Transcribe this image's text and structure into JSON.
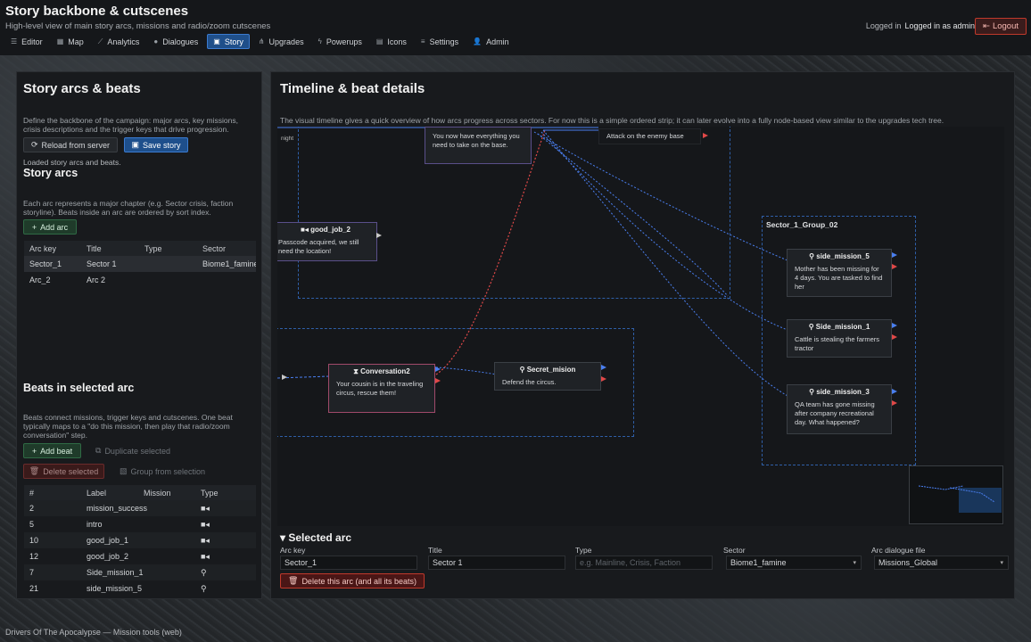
{
  "app": {
    "title": "Story backbone & cutscenes",
    "subtitle": "High-level view of main story arcs, missions and radio/zoom cutscenes",
    "login_status": "Logged in",
    "login_user": "Logged in as admin",
    "logout_label": "Logout"
  },
  "nav": [
    {
      "label": "Editor",
      "icon": "list-icon"
    },
    {
      "label": "Map",
      "icon": "map-icon"
    },
    {
      "label": "Analytics",
      "icon": "chart-icon"
    },
    {
      "label": "Dialogues",
      "icon": "chat-icon"
    },
    {
      "label": "Story",
      "icon": "book-icon",
      "active": true
    },
    {
      "label": "Upgrades",
      "icon": "tree-icon"
    },
    {
      "label": "Powerups",
      "icon": "bolt-icon"
    },
    {
      "label": "Icons",
      "icon": "grid-icon"
    },
    {
      "label": "Settings",
      "icon": "sliders-icon"
    },
    {
      "label": "Admin",
      "icon": "users-icon"
    }
  ],
  "left": {
    "title": "Story arcs & beats",
    "description": "Define the backbone of the campaign: major arcs, key missions, crisis descriptions and the trigger keys that drive progression.",
    "reload_label": "Reload from server",
    "save_label": "Save story",
    "status": "Loaded story arcs and beats.",
    "arcs_title": "Story arcs",
    "arcs_desc": "Each arc represents a major chapter (e.g. Sector crisis, faction storyline). Beats inside an arc are ordered by sort index.",
    "add_arc_label": "Add arc",
    "arc_columns": [
      "Arc key",
      "Title",
      "Type",
      "Sector"
    ],
    "arcs": [
      {
        "key": "Sector_1",
        "title": "Sector 1",
        "type": "",
        "sector": "Biome1_famine"
      },
      {
        "key": "Arc_2",
        "title": "Arc 2",
        "type": "",
        "sector": ""
      }
    ],
    "beats_title": "Beats in selected arc",
    "beats_desc": "Beats connect missions, trigger keys and cutscenes. One beat typically maps to a \"do this mission, then play that radio/zoom conversation\" step.",
    "add_beat_label": "Add beat",
    "duplicate_label": "Duplicate selected",
    "delete_selected_label": "Delete selected",
    "group_label": "Group from selection",
    "beat_columns": [
      "#",
      "Label",
      "Mission",
      "Type"
    ],
    "beats": [
      {
        "num": "2",
        "label": "mission_success",
        "mission": "",
        "type_icon": "video-icon"
      },
      {
        "num": "5",
        "label": "intro",
        "mission": "",
        "type_icon": "video-icon"
      },
      {
        "num": "10",
        "label": "good_job_1",
        "mission": "",
        "type_icon": "video-icon"
      },
      {
        "num": "12",
        "label": "good_job_2",
        "mission": "",
        "type_icon": "video-icon"
      },
      {
        "num": "7",
        "label": "Side_mission_1",
        "mission": "",
        "type_icon": "pin-icon"
      },
      {
        "num": "21",
        "label": "side_mission_5",
        "mission": "",
        "type_icon": "pin-icon"
      }
    ]
  },
  "right": {
    "title": "Timeline & beat details",
    "description": "The visual timeline gives a quick overview of how arcs progress across sectors. For now this is a simple ordered strip; it can later evolve into a fully node-based view similar to the upgrades tech tree.",
    "nodes": {
      "partial_text": "night",
      "top_body": "You now have everything you need to take on the base.",
      "attack_text": "Attack on the enemy base",
      "good_job_2_title": "good_job_2",
      "good_job_2_body": "Passcode acquired, we still need the location!",
      "conversation2_title": "Conversation2",
      "conversation2_body": "Your cousin is in the traveling circus, rescue them!",
      "secret_title": "Secret_mision",
      "secret_body": "Defend the circus.",
      "group_title": "Sector_1_Group_02",
      "side5_title": "side_mission_5",
      "side5_body": "Mother has been missing for 4 days. You are tasked to find her",
      "side1_title": "Side_mission_1",
      "side1_body": "Cattle is stealing the farmers tractor",
      "side3_title": "side_mission_3",
      "side3_body": "QA team has gone missing after company recreational day. What happened?"
    },
    "selected_arc_title": "Selected arc",
    "fields": {
      "arc_key_label": "Arc key",
      "arc_key_value": "Sector_1",
      "title_label": "Title",
      "title_value": "Sector 1",
      "type_label": "Type",
      "type_placeholder": "e.g. Mainline, Crisis, Faction",
      "sector_label": "Sector",
      "sector_value": "Biome1_famine",
      "dialogue_label": "Arc dialogue file",
      "dialogue_value": "Missions_Global"
    },
    "delete_arc_label": "Delete this arc (and all its beats)"
  },
  "footer": "Drivers Of The Apocalypse — Mission tools (web)",
  "colors": {
    "accent": "#1f4f8a",
    "link_blue": "#4a7ff0",
    "link_red": "#e04848",
    "danger": "#c0392b"
  }
}
